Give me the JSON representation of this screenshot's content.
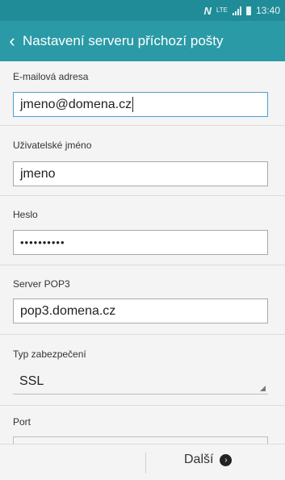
{
  "status_bar": {
    "nfc_icon": "N",
    "network": "LTE",
    "time": "13:40"
  },
  "header": {
    "back_icon": "‹",
    "title": "Nastavení serveru příchozí pošty"
  },
  "form": {
    "email": {
      "label": "E-mailová adresa",
      "value": "jmeno@domena.cz"
    },
    "username": {
      "label": "Uživatelské jméno",
      "value": "jmeno"
    },
    "password": {
      "label": "Heslo",
      "value": "••••••••••"
    },
    "server": {
      "label": "Server POP3",
      "value": "pop3.domena.cz"
    },
    "security": {
      "label": "Typ zabezpečení",
      "value": "SSL"
    },
    "port": {
      "label": "Port",
      "value": ""
    }
  },
  "footer": {
    "next_label": "Další",
    "next_icon": "›"
  },
  "colors": {
    "status_bar": "#1f8c97",
    "action_bar": "#2a9aa6",
    "focus_border": "#4b9fd6"
  }
}
